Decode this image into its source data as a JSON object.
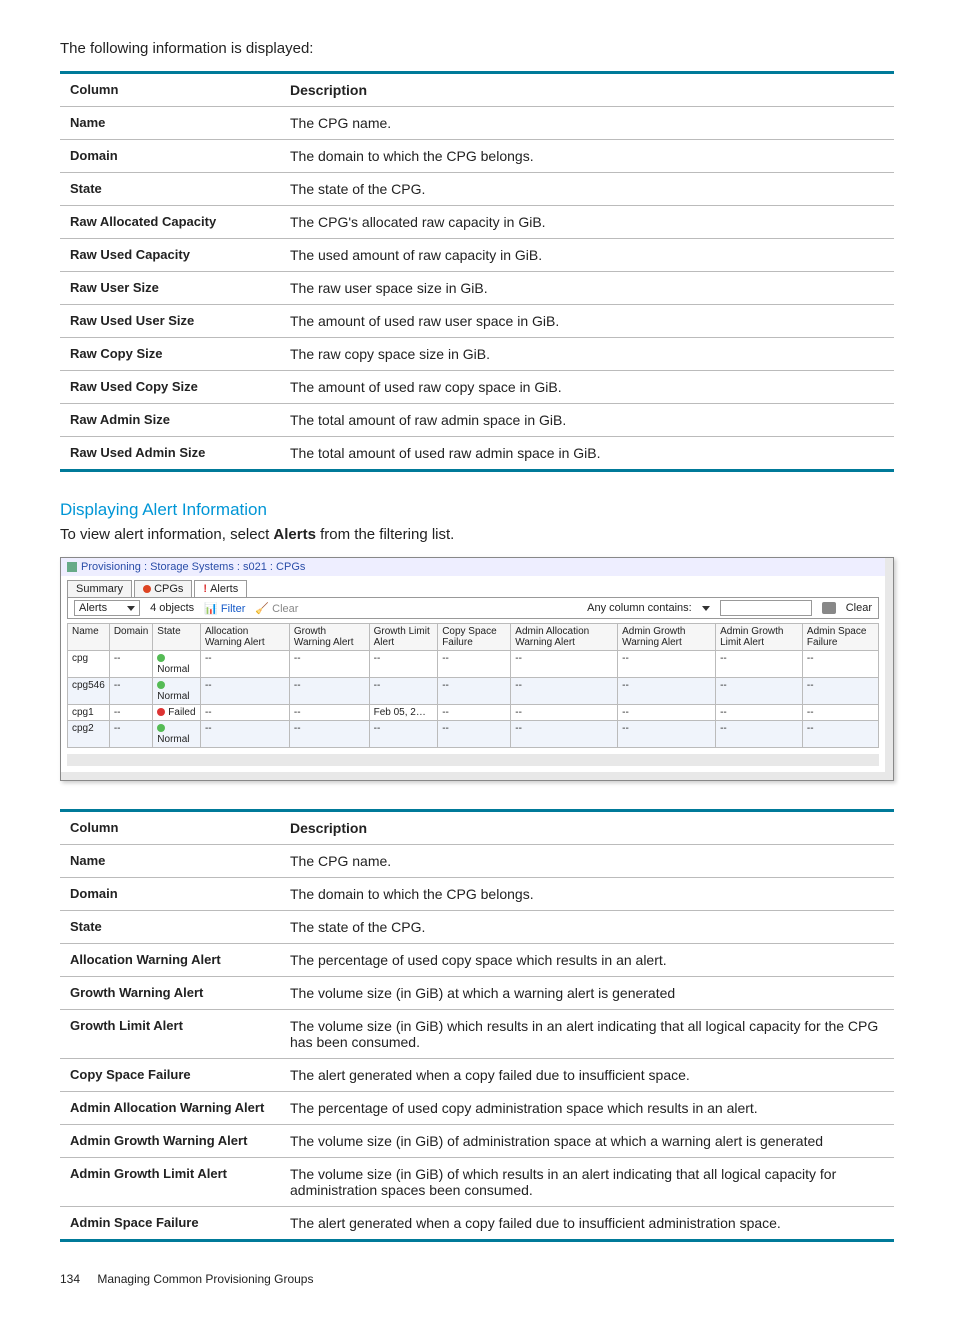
{
  "intro": "The following information is displayed:",
  "t1_head": {
    "c1": "Column",
    "c2": "Description"
  },
  "t1": [
    {
      "c": "Name",
      "d": "The CPG name."
    },
    {
      "c": "Domain",
      "d": "The domain to which the CPG belongs."
    },
    {
      "c": "State",
      "d": "The state of the CPG."
    },
    {
      "c": "Raw Allocated Capacity",
      "d": "The CPG's allocated raw capacity in GiB."
    },
    {
      "c": "Raw Used Capacity",
      "d": "The used amount of raw capacity in GiB."
    },
    {
      "c": "Raw User Size",
      "d": "The raw user space size in GiB."
    },
    {
      "c": "Raw Used User Size",
      "d": "The amount of used raw user space in GiB."
    },
    {
      "c": "Raw Copy Size",
      "d": "The raw copy space size in GiB."
    },
    {
      "c": "Raw Used Copy Size",
      "d": "The amount of used raw copy space in GiB."
    },
    {
      "c": "Raw Admin Size",
      "d": "The total amount of raw admin space in GiB."
    },
    {
      "c": "Raw Used Admin Size",
      "d": "The total amount of used raw admin space in GiB."
    }
  ],
  "section_head": "Displaying Alert Information",
  "section_text_a": "To view alert information, select ",
  "section_text_b": "Alerts",
  "section_text_c": " from the filtering list.",
  "shot": {
    "crumb": "Provisioning : Storage Systems : s021 : CPGs",
    "tabs": {
      "summary": "Summary",
      "cpgs": "CPGs",
      "alerts": "Alerts"
    },
    "bar": {
      "sel": "Alerts",
      "count": "4 objects",
      "filter": "Filter",
      "clear": "Clear",
      "anycol": "Any column contains:",
      "clear2": "Clear"
    },
    "cols": [
      "Name",
      "Domain",
      "State",
      "Allocation Warning Alert",
      "Growth Warning Alert",
      "Growth Limit Alert",
      "Copy Space Failure",
      "Admin Allocation Warning Alert",
      "Admin Growth Warning Alert",
      "Admin Growth Limit Alert",
      "Admin Space Failure"
    ],
    "rows": [
      {
        "n": "cpg",
        "dom": "--",
        "st": "Normal",
        "ok": true,
        "v": [
          "--",
          "--",
          "--",
          "--",
          "--",
          "--",
          "--",
          "--"
        ]
      },
      {
        "n": "cpg546",
        "dom": "--",
        "st": "Normal",
        "ok": true,
        "v": [
          "--",
          "--",
          "--",
          "--",
          "--",
          "--",
          "--",
          "--"
        ]
      },
      {
        "n": "cpg1",
        "dom": "--",
        "st": "Failed",
        "ok": false,
        "v": [
          "--",
          "--",
          "Feb 05, 2…",
          "--",
          "--",
          "--",
          "--",
          "--"
        ]
      },
      {
        "n": "cpg2",
        "dom": "--",
        "st": "Normal",
        "ok": true,
        "v": [
          "--",
          "--",
          "--",
          "--",
          "--",
          "--",
          "--",
          "--"
        ]
      }
    ]
  },
  "t2_head": {
    "c1": "Column",
    "c2": "Description"
  },
  "t2": [
    {
      "c": "Name",
      "d": "The CPG name."
    },
    {
      "c": "Domain",
      "d": "The domain to which the CPG belongs."
    },
    {
      "c": "State",
      "d": "The state of the CPG."
    },
    {
      "c": "Allocation Warning Alert",
      "d": "The percentage of used copy space which results in an alert."
    },
    {
      "c": "Growth Warning Alert",
      "d": "The volume size (in GiB) at which a warning alert is generated"
    },
    {
      "c": "Growth Limit Alert",
      "d": "The volume size (in GiB) which results in an alert indicating that all logical capacity for the CPG has been consumed."
    },
    {
      "c": "Copy Space Failure",
      "d": "The alert generated when a copy failed due to insufficient space."
    },
    {
      "c": "Admin Allocation Warning Alert",
      "d": "The percentage of used copy administration space which results in an alert."
    },
    {
      "c": "Admin Growth Warning Alert",
      "d": "The volume size (in GiB) of administration space at which a warning alert is generated"
    },
    {
      "c": "Admin Growth Limit Alert",
      "d": "The volume size (in GiB) of which results in an alert indicating that all logical capacity for administration spaces been consumed."
    },
    {
      "c": "Admin Space Failure",
      "d": "The alert generated when a copy failed due to insufficient administration space."
    }
  ],
  "footer": {
    "page": "134",
    "title": "Managing Common Provisioning Groups"
  }
}
